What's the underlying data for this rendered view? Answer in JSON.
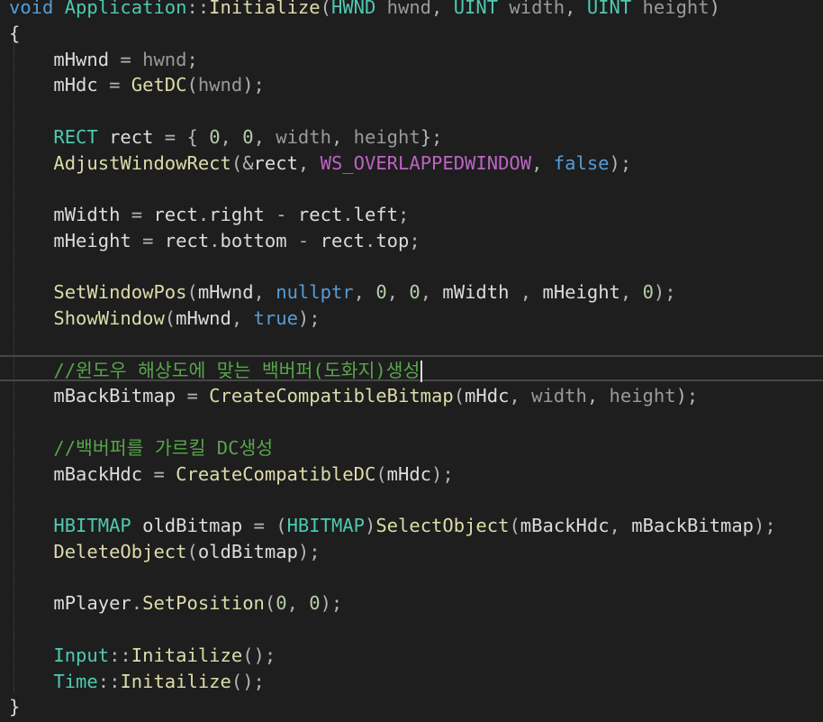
{
  "editor": {
    "language": "cpp",
    "theme_background": "#1e1e1e",
    "colors": {
      "keyword": "#569cd6",
      "class": "#4ec9b0",
      "function": "#dcdcaa",
      "parameter": "#9a9a9a",
      "number": "#b5cea8",
      "macro": "#bd63c5",
      "comment": "#57a64a"
    },
    "lines": [
      {
        "tokens": [
          {
            "t": "void",
            "c": "keyword"
          },
          {
            "t": " ",
            "c": "plain"
          },
          {
            "t": "Application",
            "c": "class"
          },
          {
            "t": "::",
            "c": "punct"
          },
          {
            "t": "Initialize",
            "c": "func"
          },
          {
            "t": "(",
            "c": "punct"
          },
          {
            "t": "HWND",
            "c": "class"
          },
          {
            "t": " hwnd",
            "c": "param"
          },
          {
            "t": ", ",
            "c": "punct"
          },
          {
            "t": "UINT",
            "c": "class"
          },
          {
            "t": " width",
            "c": "param"
          },
          {
            "t": ", ",
            "c": "punct"
          },
          {
            "t": "UINT",
            "c": "class"
          },
          {
            "t": " height",
            "c": "param"
          },
          {
            "t": ")",
            "c": "punct"
          }
        ]
      },
      {
        "tokens": [
          {
            "t": "{",
            "c": "plain"
          }
        ]
      },
      {
        "tokens": [
          {
            "t": "    mHwnd",
            "c": "var"
          },
          {
            "t": " = ",
            "c": "punct"
          },
          {
            "t": "hwnd",
            "c": "param"
          },
          {
            "t": ";",
            "c": "punct"
          }
        ]
      },
      {
        "tokens": [
          {
            "t": "    mHdc",
            "c": "var"
          },
          {
            "t": " = ",
            "c": "punct"
          },
          {
            "t": "GetDC",
            "c": "func"
          },
          {
            "t": "(",
            "c": "punct"
          },
          {
            "t": "hwnd",
            "c": "param"
          },
          {
            "t": ");",
            "c": "punct"
          }
        ]
      },
      {
        "tokens": []
      },
      {
        "tokens": [
          {
            "t": "    ",
            "c": "plain"
          },
          {
            "t": "RECT",
            "c": "class"
          },
          {
            "t": " ",
            "c": "plain"
          },
          {
            "t": "rect",
            "c": "var"
          },
          {
            "t": " = { ",
            "c": "punct"
          },
          {
            "t": "0",
            "c": "num"
          },
          {
            "t": ", ",
            "c": "punct"
          },
          {
            "t": "0",
            "c": "num"
          },
          {
            "t": ", ",
            "c": "punct"
          },
          {
            "t": "width",
            "c": "param"
          },
          {
            "t": ", ",
            "c": "punct"
          },
          {
            "t": "height",
            "c": "param"
          },
          {
            "t": "};",
            "c": "punct"
          }
        ]
      },
      {
        "tokens": [
          {
            "t": "    ",
            "c": "plain"
          },
          {
            "t": "AdjustWindowRect",
            "c": "func"
          },
          {
            "t": "(&",
            "c": "punct"
          },
          {
            "t": "rect",
            "c": "var"
          },
          {
            "t": ", ",
            "c": "punct"
          },
          {
            "t": "WS_OVERLAPPEDWINDOW",
            "c": "macro"
          },
          {
            "t": ", ",
            "c": "punct"
          },
          {
            "t": "false",
            "c": "keyword"
          },
          {
            "t": ");",
            "c": "punct"
          }
        ]
      },
      {
        "tokens": []
      },
      {
        "tokens": [
          {
            "t": "    mWidth",
            "c": "var"
          },
          {
            "t": " = ",
            "c": "punct"
          },
          {
            "t": "rect",
            "c": "var"
          },
          {
            "t": ".",
            "c": "punct"
          },
          {
            "t": "right",
            "c": "member"
          },
          {
            "t": " - ",
            "c": "punct"
          },
          {
            "t": "rect",
            "c": "var"
          },
          {
            "t": ".",
            "c": "punct"
          },
          {
            "t": "left",
            "c": "member"
          },
          {
            "t": ";",
            "c": "punct"
          }
        ]
      },
      {
        "tokens": [
          {
            "t": "    mHeight",
            "c": "var"
          },
          {
            "t": " = ",
            "c": "punct"
          },
          {
            "t": "rect",
            "c": "var"
          },
          {
            "t": ".",
            "c": "punct"
          },
          {
            "t": "bottom",
            "c": "member"
          },
          {
            "t": " - ",
            "c": "punct"
          },
          {
            "t": "rect",
            "c": "var"
          },
          {
            "t": ".",
            "c": "punct"
          },
          {
            "t": "top",
            "c": "member"
          },
          {
            "t": ";",
            "c": "punct"
          }
        ]
      },
      {
        "tokens": []
      },
      {
        "tokens": [
          {
            "t": "    ",
            "c": "plain"
          },
          {
            "t": "SetWindowPos",
            "c": "func"
          },
          {
            "t": "(",
            "c": "punct"
          },
          {
            "t": "mHwnd",
            "c": "var"
          },
          {
            "t": ", ",
            "c": "punct"
          },
          {
            "t": "nullptr",
            "c": "keyword"
          },
          {
            "t": ", ",
            "c": "punct"
          },
          {
            "t": "0",
            "c": "num"
          },
          {
            "t": ", ",
            "c": "punct"
          },
          {
            "t": "0",
            "c": "num"
          },
          {
            "t": ", ",
            "c": "punct"
          },
          {
            "t": "mWidth",
            "c": "var"
          },
          {
            "t": " , ",
            "c": "punct"
          },
          {
            "t": "mHeight",
            "c": "var"
          },
          {
            "t": ", ",
            "c": "punct"
          },
          {
            "t": "0",
            "c": "num"
          },
          {
            "t": ");",
            "c": "punct"
          }
        ]
      },
      {
        "tokens": [
          {
            "t": "    ",
            "c": "plain"
          },
          {
            "t": "ShowWindow",
            "c": "func"
          },
          {
            "t": "(",
            "c": "punct"
          },
          {
            "t": "mHwnd",
            "c": "var"
          },
          {
            "t": ", ",
            "c": "punct"
          },
          {
            "t": "true",
            "c": "keyword"
          },
          {
            "t": ");",
            "c": "punct"
          }
        ]
      },
      {
        "tokens": []
      },
      {
        "tokens": [
          {
            "t": "    //윈도우 해상도에 맞는 백버퍼(도화지)생성",
            "c": "comment"
          }
        ],
        "caret": true
      },
      {
        "tokens": [
          {
            "t": "    mBackBitmap",
            "c": "var"
          },
          {
            "t": " = ",
            "c": "punct"
          },
          {
            "t": "CreateCompatibleBitmap",
            "c": "func"
          },
          {
            "t": "(",
            "c": "punct"
          },
          {
            "t": "mHdc",
            "c": "var"
          },
          {
            "t": ", ",
            "c": "punct"
          },
          {
            "t": "width",
            "c": "param"
          },
          {
            "t": ", ",
            "c": "punct"
          },
          {
            "t": "height",
            "c": "param"
          },
          {
            "t": ");",
            "c": "punct"
          }
        ]
      },
      {
        "tokens": []
      },
      {
        "tokens": [
          {
            "t": "    //백버퍼를 가르킬 DC생성",
            "c": "comment"
          }
        ]
      },
      {
        "tokens": [
          {
            "t": "    mBackHdc",
            "c": "var"
          },
          {
            "t": " = ",
            "c": "punct"
          },
          {
            "t": "CreateCompatibleDC",
            "c": "func"
          },
          {
            "t": "(",
            "c": "punct"
          },
          {
            "t": "mHdc",
            "c": "var"
          },
          {
            "t": ");",
            "c": "punct"
          }
        ]
      },
      {
        "tokens": []
      },
      {
        "tokens": [
          {
            "t": "    ",
            "c": "plain"
          },
          {
            "t": "HBITMAP",
            "c": "class"
          },
          {
            "t": " ",
            "c": "plain"
          },
          {
            "t": "oldBitmap",
            "c": "var"
          },
          {
            "t": " = (",
            "c": "punct"
          },
          {
            "t": "HBITMAP",
            "c": "class"
          },
          {
            "t": ")",
            "c": "punct"
          },
          {
            "t": "SelectObject",
            "c": "func"
          },
          {
            "t": "(",
            "c": "punct"
          },
          {
            "t": "mBackHdc",
            "c": "var"
          },
          {
            "t": ", ",
            "c": "punct"
          },
          {
            "t": "mBackBitmap",
            "c": "var"
          },
          {
            "t": ");",
            "c": "punct"
          }
        ]
      },
      {
        "tokens": [
          {
            "t": "    ",
            "c": "plain"
          },
          {
            "t": "DeleteObject",
            "c": "func"
          },
          {
            "t": "(",
            "c": "punct"
          },
          {
            "t": "oldBitmap",
            "c": "var"
          },
          {
            "t": ");",
            "c": "punct"
          }
        ]
      },
      {
        "tokens": []
      },
      {
        "tokens": [
          {
            "t": "    mPlayer",
            "c": "var"
          },
          {
            "t": ".",
            "c": "punct"
          },
          {
            "t": "SetPosition",
            "c": "func"
          },
          {
            "t": "(",
            "c": "punct"
          },
          {
            "t": "0",
            "c": "num"
          },
          {
            "t": ", ",
            "c": "punct"
          },
          {
            "t": "0",
            "c": "num"
          },
          {
            "t": ");",
            "c": "punct"
          }
        ]
      },
      {
        "tokens": []
      },
      {
        "tokens": [
          {
            "t": "    ",
            "c": "plain"
          },
          {
            "t": "Input",
            "c": "class"
          },
          {
            "t": "::",
            "c": "punct"
          },
          {
            "t": "Initailize",
            "c": "func"
          },
          {
            "t": "();",
            "c": "punct"
          }
        ]
      },
      {
        "tokens": [
          {
            "t": "    ",
            "c": "plain"
          },
          {
            "t": "Time",
            "c": "class"
          },
          {
            "t": "::",
            "c": "punct"
          },
          {
            "t": "Initailize",
            "c": "func"
          },
          {
            "t": "();",
            "c": "punct"
          }
        ]
      },
      {
        "tokens": [
          {
            "t": "}",
            "c": "plain"
          }
        ]
      }
    ]
  }
}
